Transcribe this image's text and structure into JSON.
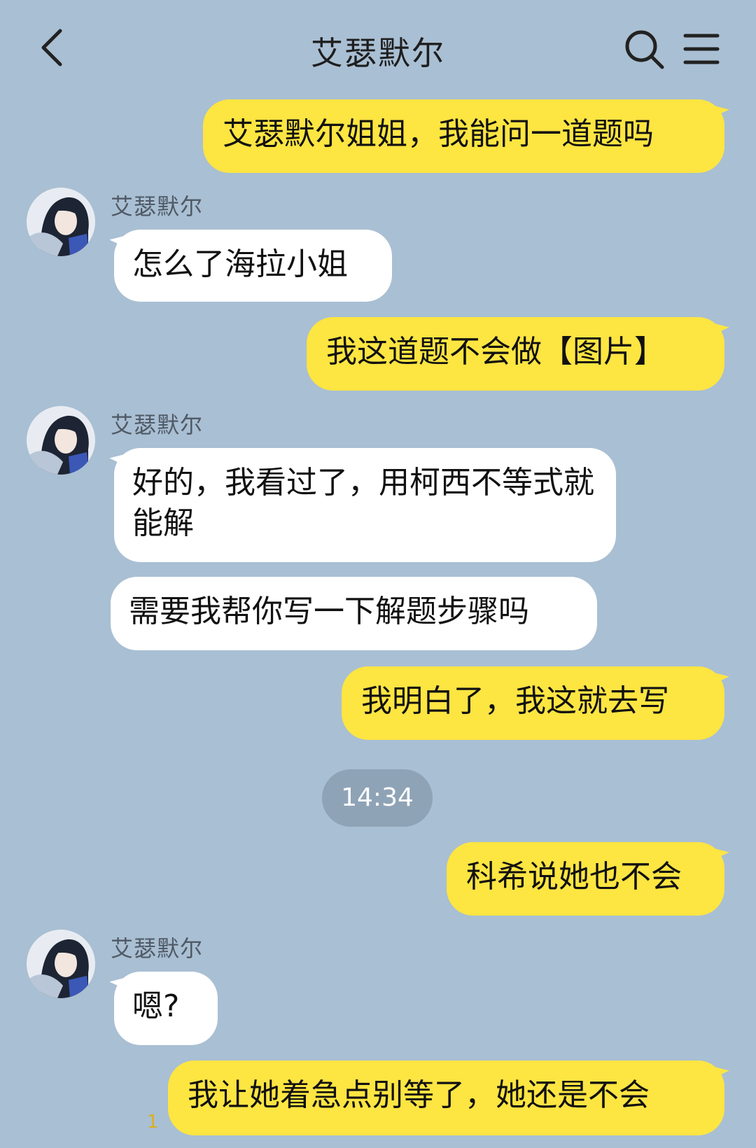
{
  "header": {
    "title": "艾瑟默尔",
    "back_icon": "chevron-left-icon",
    "search_icon": "search-icon",
    "menu_icon": "menu-icon"
  },
  "contact": {
    "name": "艾瑟默尔"
  },
  "messages": [
    {
      "side": "out",
      "text": "艾瑟默尔姐姐，我能问一道题吗"
    },
    {
      "side": "in",
      "sender": "艾瑟默尔",
      "text": "怎么了海拉小姐"
    },
    {
      "side": "out",
      "text": "我这道题不会做【图片】"
    },
    {
      "side": "in",
      "sender": "艾瑟默尔",
      "text": "好的，我看过了，用柯西不等式就能解"
    },
    {
      "side": "in",
      "text": "需要我帮你写一下解题步骤吗"
    },
    {
      "side": "out",
      "text": "我明白了，我这就去写"
    },
    {
      "side": "out",
      "text": "科希说她也不会"
    },
    {
      "side": "in",
      "sender": "艾瑟默尔",
      "text": "嗯?"
    },
    {
      "side": "out",
      "text": "我让她着急点别等了，她还是不会"
    }
  ],
  "timestamp": "14:34",
  "unread_count": "1",
  "colors": {
    "background": "#a9bfd3",
    "outgoing_bubble": "#fde542",
    "incoming_bubble": "#ffffff",
    "timestamp_pill": "#8fa3b6"
  }
}
